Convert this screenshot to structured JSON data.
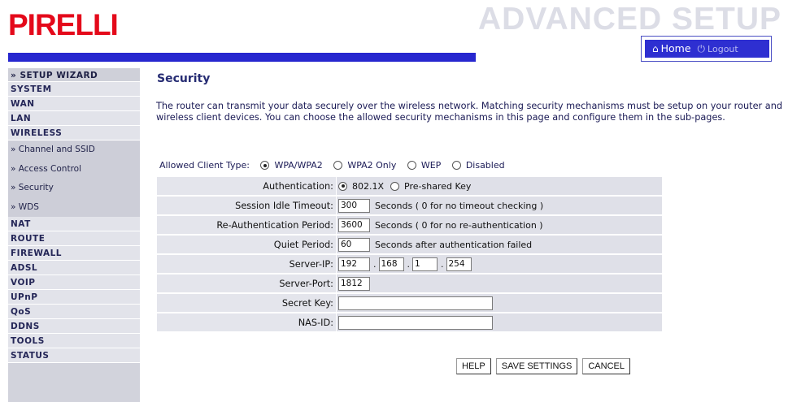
{
  "header": {
    "logo_text": "PIRELLI",
    "title": "ADVANCED SETUP",
    "home_label": "Home",
    "logout_label": "Logout",
    "home_icon": "home-icon",
    "logout_icon": "power-icon"
  },
  "sidebar": {
    "items": [
      {
        "label": "» SETUP WIZARD"
      },
      {
        "label": "SYSTEM"
      },
      {
        "label": "WAN"
      },
      {
        "label": "LAN"
      },
      {
        "label": "WIRELESS"
      }
    ],
    "sub_items": [
      {
        "label": "» Channel and SSID"
      },
      {
        "label": "» Access Control"
      },
      {
        "label": "» Security"
      },
      {
        "label": "» WDS"
      }
    ],
    "items_after": [
      {
        "label": "NAT"
      },
      {
        "label": "ROUTE"
      },
      {
        "label": "FIREWALL"
      },
      {
        "label": "ADSL"
      },
      {
        "label": "VOIP"
      },
      {
        "label": "UPnP"
      },
      {
        "label": "QoS"
      },
      {
        "label": "DDNS"
      },
      {
        "label": "TOOLS"
      },
      {
        "label": "STATUS"
      }
    ]
  },
  "main": {
    "title": "Security",
    "intro": "The router can transmit your data securely over the wireless network. Matching security mechanisms must be setup on your router and wireless client devices. You can choose the allowed security mechanisms in this page and configure them in the sub-pages.",
    "client_type": {
      "label": "Allowed Client Type:",
      "options": [
        "WPA/WPA2",
        "WPA2 Only",
        "WEP",
        "Disabled"
      ],
      "selected": "WPA/WPA2"
    },
    "form": {
      "authentication": {
        "label": "Authentication:",
        "options": [
          "802.1X",
          "Pre-shared Key"
        ],
        "selected": "802.1X"
      },
      "session_idle_timeout": {
        "label": "Session Idle Timeout:",
        "value": "300",
        "note": "Seconds ( 0 for no timeout checking )"
      },
      "reauth_period": {
        "label": "Re-Authentication Period:",
        "value": "3600",
        "note": "Seconds ( 0 for no re-authentication )"
      },
      "quiet_period": {
        "label": "Quiet Period:",
        "value": "60",
        "note": "Seconds after authentication failed"
      },
      "server_ip": {
        "label": "Server-IP:",
        "octets": [
          "192",
          "168",
          "1",
          "254"
        ]
      },
      "server_port": {
        "label": "Server-Port:",
        "value": "1812"
      },
      "secret_key": {
        "label": "Secret Key:",
        "value": ""
      },
      "nas_id": {
        "label": "NAS-ID:",
        "value": ""
      }
    },
    "buttons": {
      "help": "HELP",
      "save": "SAVE SETTINGS",
      "cancel": "CANCEL"
    }
  },
  "colors": {
    "brand_red": "#e4091a",
    "accent_blue": "#2727cf",
    "sidebar_bg": "#d2d3dc",
    "title_text": "#262c73"
  }
}
